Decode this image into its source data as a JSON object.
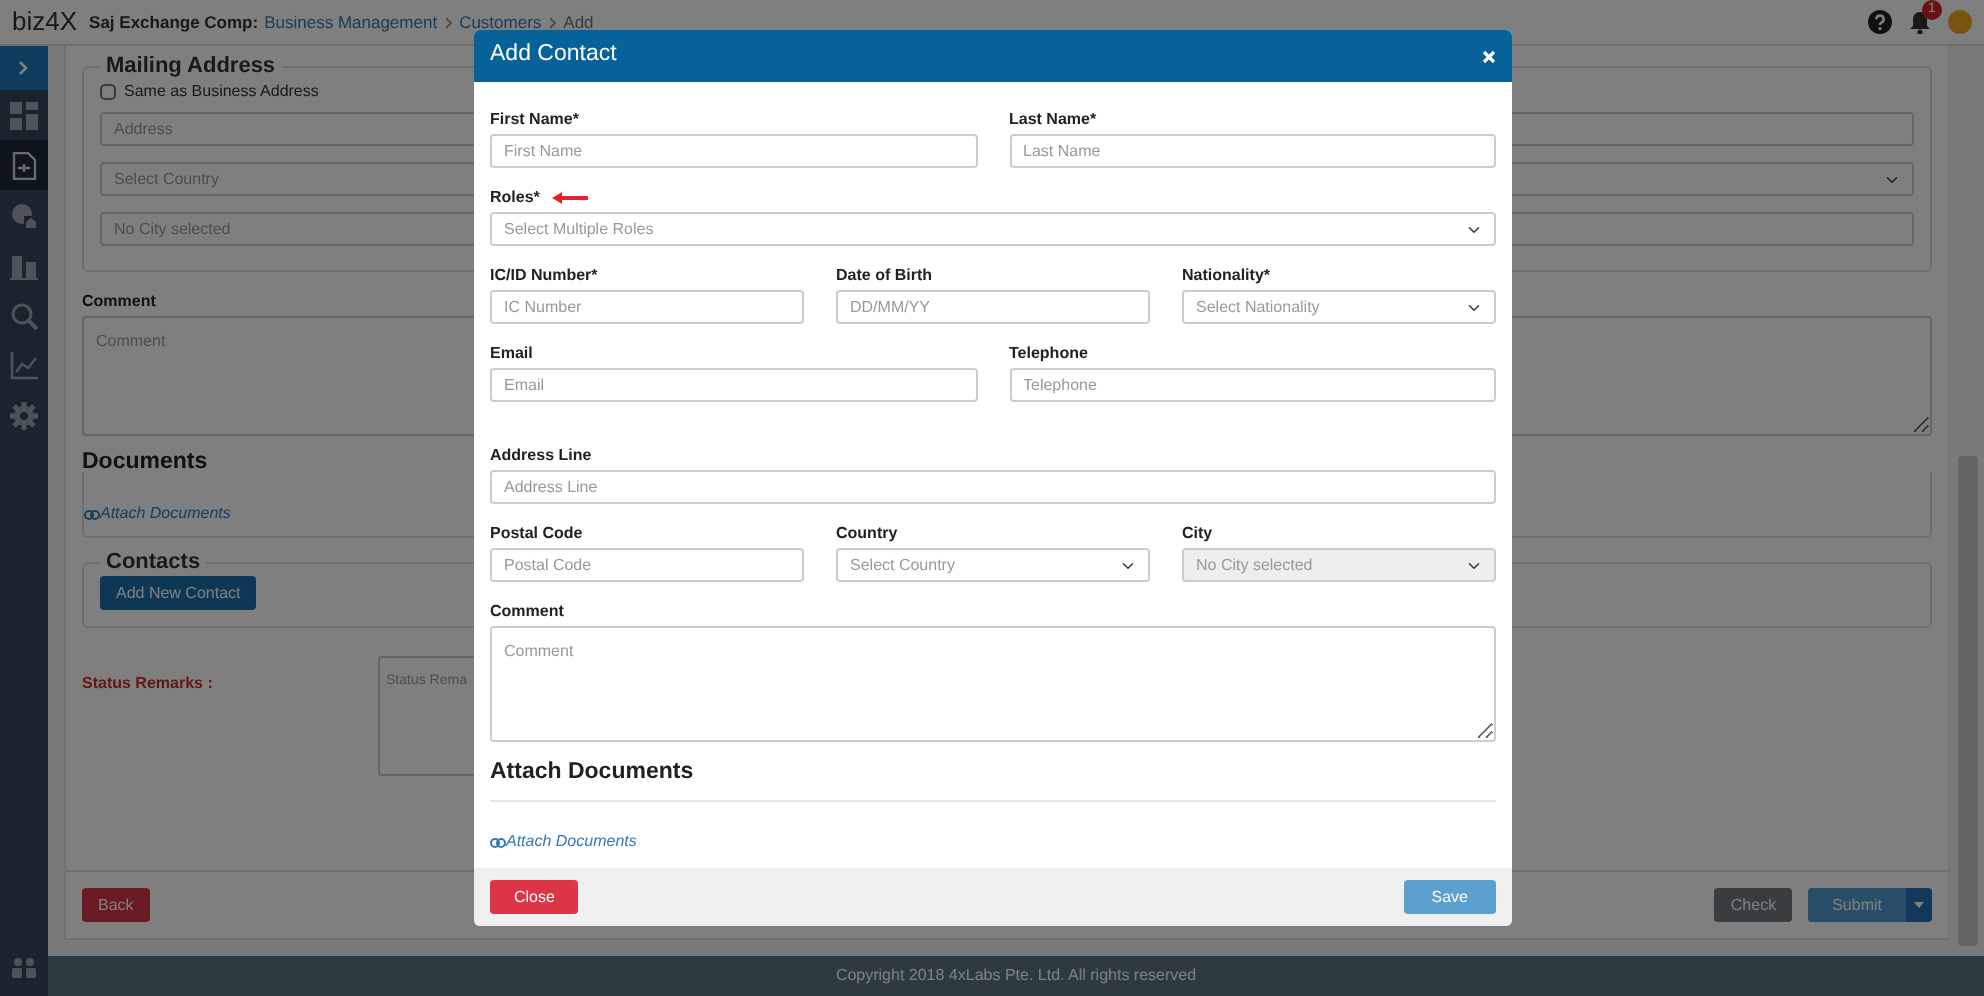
{
  "header": {
    "logo": "biz4X",
    "company": "Saj Exchange Comp:",
    "breadcrumbs": [
      {
        "label": "Business Management",
        "kind": "link"
      },
      {
        "label": "Customers",
        "kind": "link"
      },
      {
        "label": "Add",
        "kind": "current"
      }
    ],
    "notification_count": "1"
  },
  "sidebar": {
    "items": [
      {
        "kind": "dashboard",
        "selected": false
      },
      {
        "kind": "document",
        "selected": true
      },
      {
        "kind": "globe",
        "selected": false
      },
      {
        "kind": "buildings",
        "selected": false
      },
      {
        "kind": "search",
        "selected": false
      },
      {
        "kind": "chart",
        "selected": false
      },
      {
        "kind": "gear",
        "selected": false
      }
    ]
  },
  "form": {
    "mailing_address": {
      "title": "Mailing Address",
      "same_as_business": {
        "label": "Same as Business Address",
        "checked": false
      },
      "address": {
        "placeholder": "Address"
      },
      "country": {
        "placeholder": "Select Country"
      },
      "city": {
        "placeholder": "No City selected"
      }
    },
    "comment": {
      "label": "Comment",
      "placeholder": "Comment"
    },
    "documents": {
      "title": "Documents",
      "link": "Attach Documents"
    },
    "contacts": {
      "title": "Contacts",
      "button": "Add New Contact"
    },
    "status_remarks": {
      "label": "Status Remarks :",
      "placeholder": "Status Rema"
    }
  },
  "actions": {
    "back": "Back",
    "check": "Check",
    "submit": "Submit"
  },
  "footer": "Copyright 2018 4xLabs Pte. Ltd. All rights reserved",
  "modal": {
    "title": "Add Contact",
    "rows": [
      {
        "fields": [
          {
            "label": "First Name*",
            "placeholder": "First Name",
            "kind": "input",
            "disabled": false,
            "pointer": false
          },
          {
            "label": "Last Name*",
            "placeholder": "Last Name",
            "kind": "input",
            "disabled": false,
            "pointer": false
          }
        ]
      },
      {
        "fields": [
          {
            "label": "Roles*",
            "placeholder": "Select Multiple Roles",
            "kind": "select",
            "disabled": false,
            "pointer": true
          }
        ]
      },
      {
        "fields": [
          {
            "label": "IC/ID Number*",
            "placeholder": "IC Number",
            "kind": "input",
            "disabled": false,
            "pointer": false
          },
          {
            "label": "Date of Birth",
            "placeholder": "DD/MM/YY",
            "kind": "input",
            "disabled": false,
            "pointer": false
          },
          {
            "label": "Nationality*",
            "placeholder": "Select Nationality",
            "kind": "select",
            "disabled": false,
            "pointer": false
          }
        ]
      },
      {
        "fields": [
          {
            "label": "Email",
            "placeholder": "Email",
            "kind": "input",
            "disabled": false,
            "pointer": false
          },
          {
            "label": "Telephone",
            "placeholder": "Telephone",
            "kind": "input",
            "disabled": false,
            "pointer": false
          }
        ]
      },
      {
        "fields": [
          {
            "label": "Address Line",
            "placeholder": "Address Line",
            "kind": "input",
            "disabled": false,
            "pointer": false
          }
        ]
      },
      {
        "fields": [
          {
            "label": "Postal Code",
            "placeholder": "Postal Code",
            "kind": "input",
            "disabled": false,
            "pointer": false
          },
          {
            "label": "Country",
            "placeholder": "Select Country",
            "kind": "select",
            "disabled": false,
            "pointer": false
          },
          {
            "label": "City",
            "placeholder": "No City selected",
            "kind": "select",
            "disabled": true,
            "pointer": false
          }
        ]
      },
      {
        "fields": [
          {
            "label": "Comment",
            "placeholder": "Comment",
            "kind": "textarea",
            "disabled": false,
            "pointer": false
          }
        ]
      }
    ],
    "attach_title": "Attach Documents",
    "attach_link": "Attach Documents",
    "close": "Close",
    "save": "Save"
  }
}
